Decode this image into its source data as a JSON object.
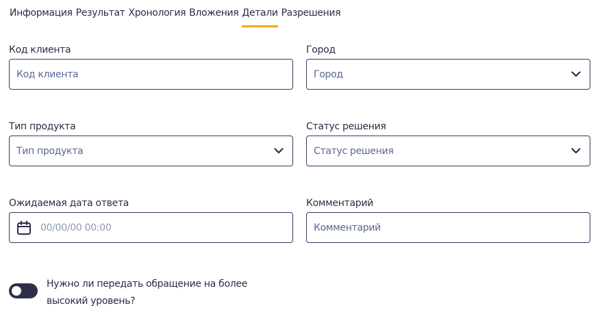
{
  "tabs": [
    {
      "label": "Информация"
    },
    {
      "label": "Результат"
    },
    {
      "label": "Хронология"
    },
    {
      "label": "Вложения"
    },
    {
      "label": "Детали",
      "active": true
    },
    {
      "label": "Разрешения"
    }
  ],
  "fields": {
    "client_code": {
      "label": "Код клиента",
      "placeholder": "Код клиента"
    },
    "city": {
      "label": "Город",
      "selected": "Город"
    },
    "product_type": {
      "label": "Тип продукта",
      "selected": "Тип продукта"
    },
    "decision_status": {
      "label": "Статус решения",
      "selected": "Статус решения"
    },
    "expected_date": {
      "label": "Ожидаемая дата ответа",
      "placeholder": "00/00/00 00:00"
    },
    "comment": {
      "label": "Комментарий",
      "placeholder": "Комментарий"
    }
  },
  "escalation": {
    "label": "Нужно ли передать обращение на более высокий уровень?",
    "enabled": false
  },
  "icons": {
    "dropdown": "chevron-down-icon",
    "date": "calendar-icon"
  },
  "colors": {
    "accent": "#f0a812",
    "border": "#353a60",
    "text": "#2a2c44",
    "placeholder": "#5a6794",
    "toggle": "#2c2e4a"
  }
}
